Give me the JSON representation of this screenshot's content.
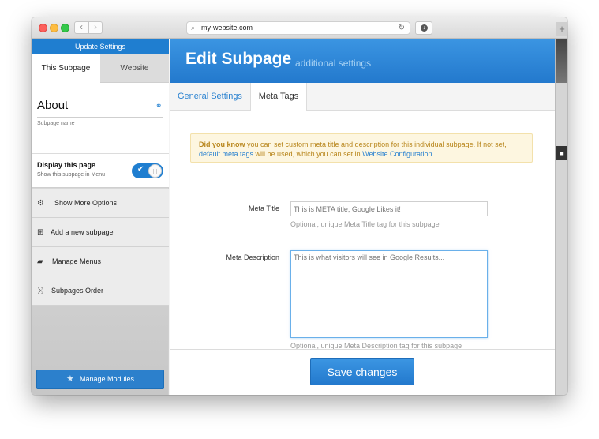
{
  "browser": {
    "url": "my-website.com",
    "back_glyph": "‹",
    "forward_glyph": "›",
    "search_glyph": "⌕",
    "reload_glyph": "↻",
    "download_glyph": "↓",
    "new_tab_glyph": "+"
  },
  "sidebar": {
    "header": "Update Settings",
    "tabs": [
      {
        "label": "This Subpage",
        "active": true
      },
      {
        "label": "Website",
        "active": false
      }
    ],
    "page_name": "About",
    "page_name_caption": "Subpage name",
    "link_glyph": "⚭",
    "display": {
      "title": "Display this page",
      "caption": "Show this subpage in Menu",
      "enabled": true,
      "check_glyph": "✔"
    },
    "items": [
      {
        "label": "Show More Options",
        "icon": "cogs-icon",
        "glyph": "⚙"
      },
      {
        "label": "Add a new subpage",
        "icon": "plus-square-icon",
        "glyph": "⊞"
      },
      {
        "label": "Manage Menus",
        "icon": "folder-open-icon",
        "glyph": "▰"
      },
      {
        "label": "Subpages Order",
        "icon": "shuffle-icon",
        "glyph": "⤨"
      }
    ],
    "modules_button": {
      "label": "Manage Modules",
      "glyph": "★"
    }
  },
  "main": {
    "title": "Edit Subpage",
    "subtitle": "additional settings",
    "tabs": [
      {
        "label": "General Settings",
        "active": false
      },
      {
        "label": "Meta Tags",
        "active": true
      }
    ],
    "alert": {
      "strong": "Did you know",
      "text1": " you can set custom meta title and description for this individual subpage. If not set, ",
      "link1": "default meta tags",
      "text2": " will be used, which you can set in ",
      "link2": "Website Configuration"
    },
    "meta_title": {
      "label": "Meta Title",
      "placeholder": "This is META title, Google Likes it!",
      "help": "Optional, unique Meta Title tag for this subpage"
    },
    "meta_description": {
      "label": "Meta Description",
      "placeholder": "This is what visitors will see in Google Results...",
      "help": "Optional, unique Meta Description tag for this subpage"
    },
    "save_label": "Save changes"
  },
  "colors": {
    "accent": "#2379cd",
    "alert_bg": "#fdf6e0",
    "alert_text": "#b8861c",
    "link": "#2a82d0"
  }
}
